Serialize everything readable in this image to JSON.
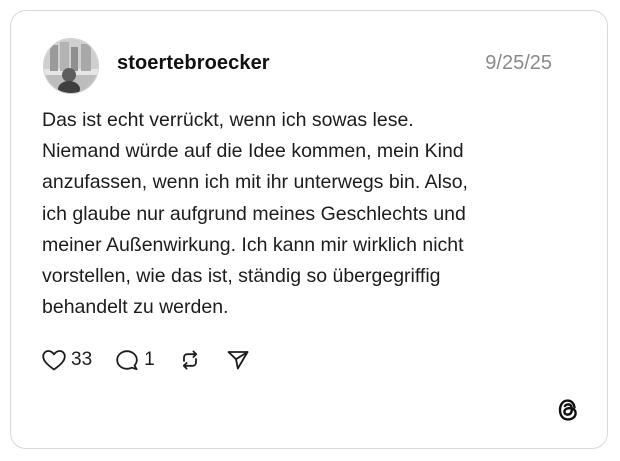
{
  "post": {
    "username": "stoertebroecker",
    "date": "9/25/25",
    "text": "Das ist echt verrückt, wenn ich sowas lese.\nNiemand würde auf die Idee kommen, mein Kind\nanzufassen, wenn ich mit ihr unterwegs bin. Also,\nich glaube nur aufgrund meines Geschlechts und\nmeiner Außenwirkung. Ich kann mir wirklich nicht\nvorstellen, wie das ist, ständig so übergegriffig\nbehandelt zu werden."
  },
  "actions": {
    "like_count": "33",
    "reply_count": "1",
    "icons": [
      "heart-icon",
      "comment-icon",
      "repost-icon",
      "share-icon"
    ]
  },
  "branding": {
    "logo": "threads-logo-icon"
  }
}
